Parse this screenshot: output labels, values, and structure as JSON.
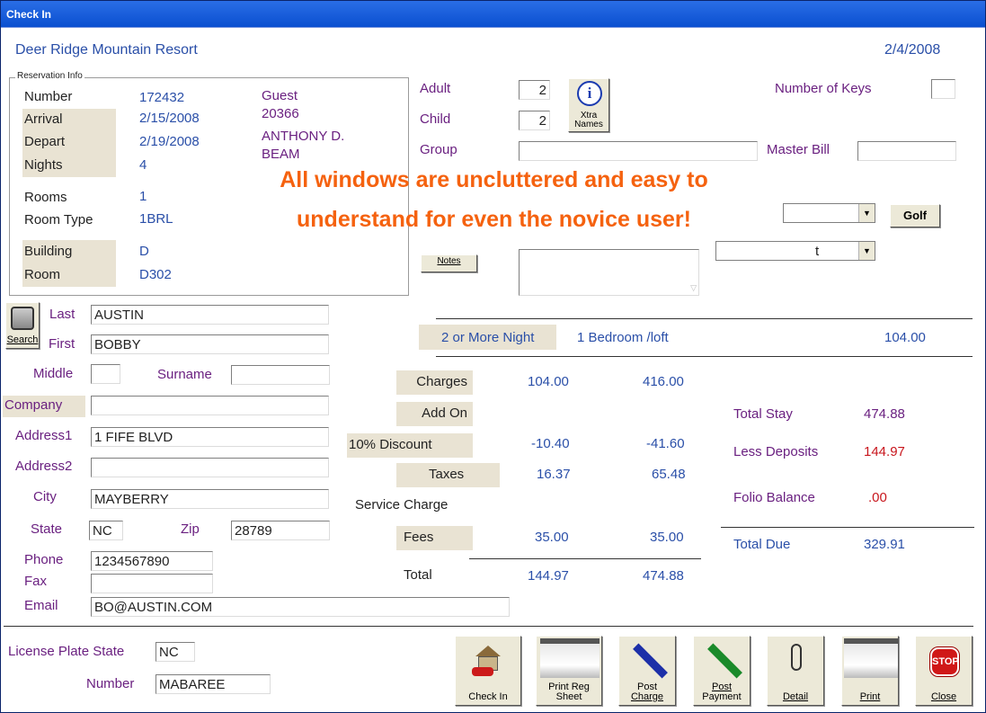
{
  "window": {
    "title": "Check In"
  },
  "header": {
    "resort": "Deer Ridge Mountain Resort",
    "date": "2/4/2008"
  },
  "reservation": {
    "group_label": "Reservation Info",
    "number_label": "Number",
    "number": "172432",
    "arrival_label": "Arrival",
    "arrival": "2/15/2008",
    "depart_label": "Depart",
    "depart": "2/19/2008",
    "nights_label": "Nights",
    "nights": "4",
    "rooms_label": "Rooms",
    "rooms": "1",
    "roomtype_label": "Room Type",
    "roomtype": "1BRL",
    "building_label": "Building",
    "building": "D",
    "room_label": "Room",
    "room": "D302",
    "guest_label": "Guest",
    "guest_id": "20366",
    "guest_name1": "ANTHONY D.",
    "guest_name2": "BEAM"
  },
  "occupancy": {
    "adult_label": "Adult",
    "adult": "2",
    "child_label": "Child",
    "child": "2",
    "group_label": "Group",
    "xtra_names_label": "Xtra Names",
    "keys_label": "Number of Keys",
    "keys": "",
    "master_bill_label": "Master Bill",
    "master_bill": "",
    "golf_label": "Golf",
    "notes_label": "Notes",
    "combo2_value": "t"
  },
  "overlay": {
    "line1": "All windows are uncluttered and easy to",
    "line2": "understand for even the novice user!"
  },
  "guest": {
    "search_label": "Search",
    "last_label": "Last",
    "last": "AUSTIN",
    "first_label": "First",
    "first": "BOBBY",
    "middle_label": "Middle",
    "middle": "",
    "surname_label": "Surname",
    "surname": "",
    "company_label": "Company",
    "company": "",
    "address1_label": "Address1",
    "address1": "1 FIFE BLVD",
    "address2_label": "Address2",
    "address2": "",
    "city_label": "City",
    "city": "MAYBERRY",
    "state_label": "State",
    "state": "NC",
    "zip_label": "Zip",
    "zip": "28789",
    "phone_label": "Phone",
    "phone": "1234567890",
    "fax_label": "Fax",
    "fax": "",
    "email_label": "Email",
    "email": "BO@AUSTIN.COM"
  },
  "rate": {
    "plan": "2 or More Night",
    "room_desc": "1 Bedroom /loft",
    "amount": "104.00"
  },
  "charges": {
    "charges_label": "Charges",
    "charges_nightly": "104.00",
    "charges_total": "416.00",
    "addon_label": "Add On",
    "discount_label": "10% Discount",
    "discount_nightly": "-10.40",
    "discount_total": "-41.60",
    "taxes_label": "Taxes",
    "taxes_nightly": "16.37",
    "taxes_total": "65.48",
    "service_label": "Service Charge",
    "fees_label": "Fees",
    "fees_nightly": "35.00",
    "fees_total": "35.00",
    "total_label": "Total",
    "total_nightly": "144.97",
    "total_total": "474.88"
  },
  "totals": {
    "total_stay_label": "Total Stay",
    "total_stay": "474.88",
    "less_deposits_label": "Less Deposits",
    "less_deposits": "144.97",
    "folio_balance_label": "Folio Balance",
    "folio_balance": ".00",
    "total_due_label": "Total Due",
    "total_due": "329.91"
  },
  "vehicle": {
    "plate_state_label": "License Plate State",
    "plate_state": "NC",
    "number_label": "Number",
    "number": "MABAREE"
  },
  "toolbar": {
    "checkin": "Check In",
    "print_reg_1": "Print Reg",
    "print_reg_2": "Sheet",
    "post_charge_1": "Post",
    "post_charge_2": "Charge",
    "post_payment_1": "Post",
    "post_payment_2": "Payment",
    "detail": "Detail",
    "print": "Print",
    "close": "Close",
    "stop_text": "STOP"
  }
}
